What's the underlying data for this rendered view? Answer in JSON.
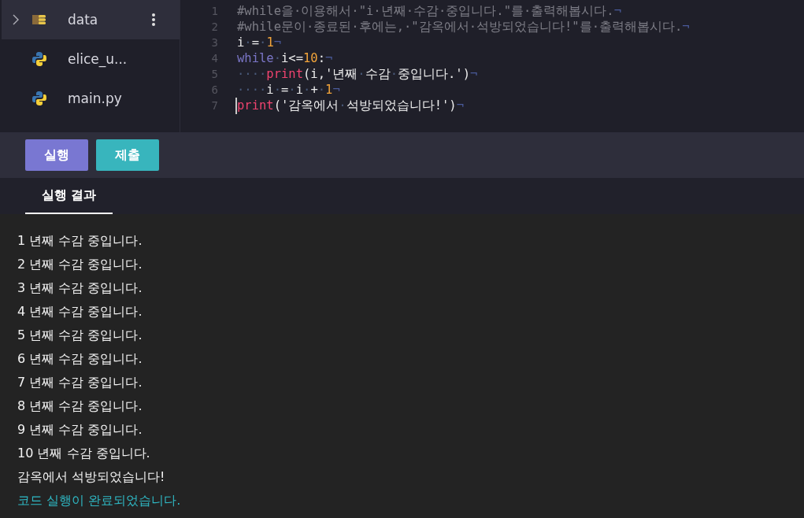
{
  "sidebar": {
    "items": [
      {
        "name": "data",
        "kind": "folder",
        "selected": true
      },
      {
        "name": "elice_u...",
        "kind": "python",
        "selected": false
      },
      {
        "name": "main.py",
        "kind": "python",
        "selected": false
      }
    ]
  },
  "editor": {
    "lines": [
      {
        "number": "1",
        "tokens": [
          {
            "kind": "comment",
            "text": "#while을·이용해서·\"i·년째·수감·중입니다.\"를·출력해봅시다."
          },
          {
            "kind": "eol",
            "text": "¬"
          }
        ]
      },
      {
        "number": "2",
        "tokens": [
          {
            "kind": "comment",
            "text": "#while문이·종료된·후에는,·\"감옥에서·석방되었습니다!\"를·출력해봅시다."
          },
          {
            "kind": "eol",
            "text": "¬"
          }
        ]
      },
      {
        "number": "3",
        "tokens": [
          {
            "kind": "plain",
            "text": "i"
          },
          {
            "kind": "ws",
            "text": "·"
          },
          {
            "kind": "plain",
            "text": "="
          },
          {
            "kind": "ws",
            "text": "·"
          },
          {
            "kind": "number",
            "text": "1"
          },
          {
            "kind": "eol",
            "text": "¬"
          }
        ]
      },
      {
        "number": "4",
        "tokens": [
          {
            "kind": "keyword",
            "text": "while"
          },
          {
            "kind": "ws",
            "text": "·"
          },
          {
            "kind": "plain",
            "text": "i<="
          },
          {
            "kind": "number",
            "text": "10"
          },
          {
            "kind": "plain",
            "text": ":"
          },
          {
            "kind": "eol",
            "text": "¬"
          }
        ]
      },
      {
        "number": "5",
        "tokens": [
          {
            "kind": "ws",
            "text": "····"
          },
          {
            "kind": "func",
            "text": "print"
          },
          {
            "kind": "plain",
            "text": "(i,'년째"
          },
          {
            "kind": "ws",
            "text": "·"
          },
          {
            "kind": "plain",
            "text": "수감"
          },
          {
            "kind": "ws",
            "text": "·"
          },
          {
            "kind": "plain",
            "text": "중입니다.')"
          },
          {
            "kind": "eol",
            "text": "¬"
          }
        ]
      },
      {
        "number": "6",
        "tokens": [
          {
            "kind": "ws",
            "text": "····"
          },
          {
            "kind": "plain",
            "text": "i"
          },
          {
            "kind": "ws",
            "text": "·"
          },
          {
            "kind": "plain",
            "text": "="
          },
          {
            "kind": "ws",
            "text": "·"
          },
          {
            "kind": "plain",
            "text": "i"
          },
          {
            "kind": "ws",
            "text": "·"
          },
          {
            "kind": "plain",
            "text": "+"
          },
          {
            "kind": "ws",
            "text": "·"
          },
          {
            "kind": "number",
            "text": "1"
          },
          {
            "kind": "eol",
            "text": "¬"
          }
        ]
      },
      {
        "number": "7",
        "cursor": true,
        "tokens": [
          {
            "kind": "func",
            "text": "print"
          },
          {
            "kind": "plain",
            "text": "('감옥에서"
          },
          {
            "kind": "ws",
            "text": "·"
          },
          {
            "kind": "plain",
            "text": "석방되었습니다!')"
          },
          {
            "kind": "eol",
            "text": "¬"
          }
        ]
      }
    ]
  },
  "buttons": [
    {
      "label": "실행",
      "kind": "run"
    },
    {
      "label": "제출",
      "kind": "submit"
    }
  ],
  "tabs": [
    {
      "label": "실행 결과",
      "selected": true
    }
  ],
  "output": {
    "lines": [
      {
        "text": "1 년째 수감 중입니다.",
        "kind": "stdout"
      },
      {
        "text": "2 년째 수감 중입니다.",
        "kind": "stdout"
      },
      {
        "text": "3 년째 수감 중입니다.",
        "kind": "stdout"
      },
      {
        "text": "4 년째 수감 중입니다.",
        "kind": "stdout"
      },
      {
        "text": "5 년째 수감 중입니다.",
        "kind": "stdout"
      },
      {
        "text": "6 년째 수감 중입니다.",
        "kind": "stdout"
      },
      {
        "text": "7 년째 수감 중입니다.",
        "kind": "stdout"
      },
      {
        "text": "8 년째 수감 중입니다.",
        "kind": "stdout"
      },
      {
        "text": "9 년째 수감 중입니다.",
        "kind": "stdout"
      },
      {
        "text": "10 년째 수감 중입니다.",
        "kind": "stdout"
      },
      {
        "text": "감옥에서 석방되었습니다!",
        "kind": "stdout"
      },
      {
        "text": "코드 실행이 완료되었습니다.",
        "kind": "status"
      }
    ]
  }
}
